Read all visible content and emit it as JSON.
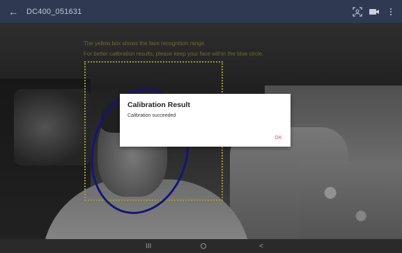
{
  "app_bar": {
    "title": "DC400_051631",
    "back_icon": "arrow-back-icon",
    "actions": [
      {
        "icon": "face-scan-icon"
      },
      {
        "icon": "camera-icon"
      },
      {
        "icon": "more-vert-icon"
      }
    ]
  },
  "overlay": {
    "hint_line_1": "The yellow box shows the face recognition range.",
    "hint_line_2": "For better calibration results, please keep your face within the blue circle.",
    "range_box_color": "#c8c845",
    "circle_color": "#1a1a9c"
  },
  "dialog": {
    "title": "Calibration Result",
    "message": "Calibration succeeded",
    "ok_label": "OK",
    "ok_color": "#e24a4a"
  },
  "nav_bar": {
    "recents_glyph": "III",
    "back_glyph": "<"
  }
}
